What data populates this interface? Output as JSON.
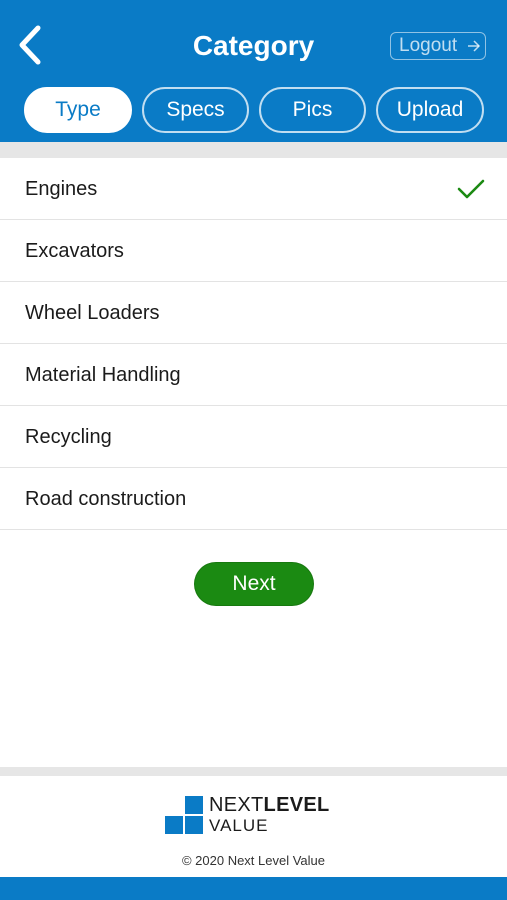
{
  "header": {
    "title": "Category",
    "logout_label": "Logout",
    "back_icon": "chevron-left-icon",
    "logout_icon": "arrow-right-icon",
    "color": "#0a7bc6"
  },
  "tabs": [
    {
      "label": "Type",
      "active": true
    },
    {
      "label": "Specs",
      "active": false
    },
    {
      "label": "Pics",
      "active": false
    },
    {
      "label": "Upload",
      "active": false
    }
  ],
  "categories": [
    {
      "label": "Engines",
      "selected": true
    },
    {
      "label": "Excavators",
      "selected": false
    },
    {
      "label": "Wheel Loaders",
      "selected": false
    },
    {
      "label": "Material Handling",
      "selected": false
    },
    {
      "label": "Recycling",
      "selected": false
    },
    {
      "label": "Road construction",
      "selected": false
    }
  ],
  "next_button": {
    "label": "Next",
    "color": "#1b8a12"
  },
  "footer": {
    "logo_word1_regular": "NEXT",
    "logo_word1_bold": "LEVEL",
    "logo_word2": "VALUE",
    "copyright": "©  2020 Next Level Value"
  }
}
